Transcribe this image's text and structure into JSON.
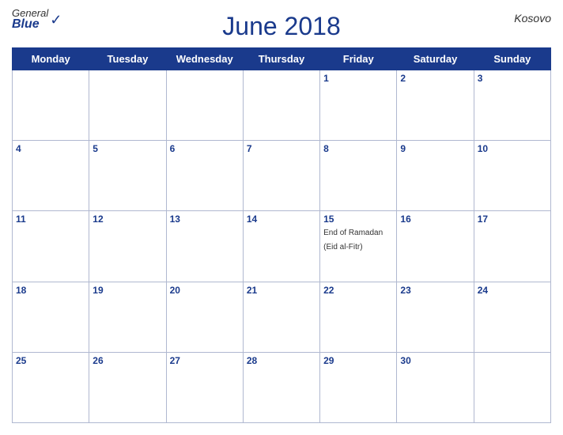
{
  "header": {
    "logo_general": "General",
    "logo_blue": "Blue",
    "title": "June 2018",
    "region": "Kosovo"
  },
  "weekdays": [
    "Monday",
    "Tuesday",
    "Wednesday",
    "Thursday",
    "Friday",
    "Saturday",
    "Sunday"
  ],
  "rows": [
    [
      {
        "day": null,
        "event": null
      },
      {
        "day": null,
        "event": null
      },
      {
        "day": null,
        "event": null
      },
      {
        "day": null,
        "event": null
      },
      {
        "day": "1",
        "event": null
      },
      {
        "day": "2",
        "event": null
      },
      {
        "day": "3",
        "event": null
      }
    ],
    [
      {
        "day": "4",
        "event": null
      },
      {
        "day": "5",
        "event": null
      },
      {
        "day": "6",
        "event": null
      },
      {
        "day": "7",
        "event": null
      },
      {
        "day": "8",
        "event": null
      },
      {
        "day": "9",
        "event": null
      },
      {
        "day": "10",
        "event": null
      }
    ],
    [
      {
        "day": "11",
        "event": null
      },
      {
        "day": "12",
        "event": null
      },
      {
        "day": "13",
        "event": null
      },
      {
        "day": "14",
        "event": null
      },
      {
        "day": "15",
        "event": "End of Ramadan (Eid al-Fitr)"
      },
      {
        "day": "16",
        "event": null
      },
      {
        "day": "17",
        "event": null
      }
    ],
    [
      {
        "day": "18",
        "event": null
      },
      {
        "day": "19",
        "event": null
      },
      {
        "day": "20",
        "event": null
      },
      {
        "day": "21",
        "event": null
      },
      {
        "day": "22",
        "event": null
      },
      {
        "day": "23",
        "event": null
      },
      {
        "day": "24",
        "event": null
      }
    ],
    [
      {
        "day": "25",
        "event": null
      },
      {
        "day": "26",
        "event": null
      },
      {
        "day": "27",
        "event": null
      },
      {
        "day": "28",
        "event": null
      },
      {
        "day": "29",
        "event": null
      },
      {
        "day": "30",
        "event": null
      },
      {
        "day": null,
        "event": null
      }
    ]
  ]
}
